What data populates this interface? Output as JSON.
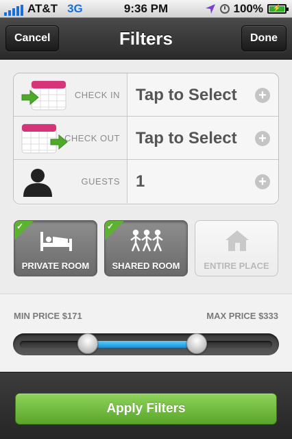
{
  "status_bar": {
    "carrier": "AT&T",
    "network": "3G",
    "time": "9:36 PM",
    "battery": "100%"
  },
  "nav": {
    "title": "Filters",
    "cancel_label": "Cancel",
    "done_label": "Done"
  },
  "form": {
    "rows": [
      {
        "label": "CHECK IN",
        "value": "Tap to Select",
        "icon": "calendar-check-in-icon"
      },
      {
        "label": "CHECK OUT",
        "value": "Tap to Select",
        "icon": "calendar-check-out-icon"
      },
      {
        "label": "GUESTS",
        "value": "1",
        "icon": "person-icon"
      }
    ]
  },
  "room_types": [
    {
      "label": "PRIVATE ROOM",
      "selected": true,
      "icon": "bed-icon"
    },
    {
      "label": "SHARED ROOM",
      "selected": true,
      "icon": "people-icon"
    },
    {
      "label": "ENTIRE PLACE",
      "selected": false,
      "icon": "house-icon"
    }
  ],
  "price": {
    "min_label": "MIN PRICE $171",
    "max_label": "MAX PRICE $333",
    "min_fraction": 0.28,
    "max_fraction": 0.69
  },
  "apply_label": "Apply Filters",
  "colors": {
    "apply_green": "#6cbb3c",
    "check_green": "#5cb32e",
    "slider_blue": "#2aa6ea",
    "calendar_pink": "#d6337a"
  }
}
